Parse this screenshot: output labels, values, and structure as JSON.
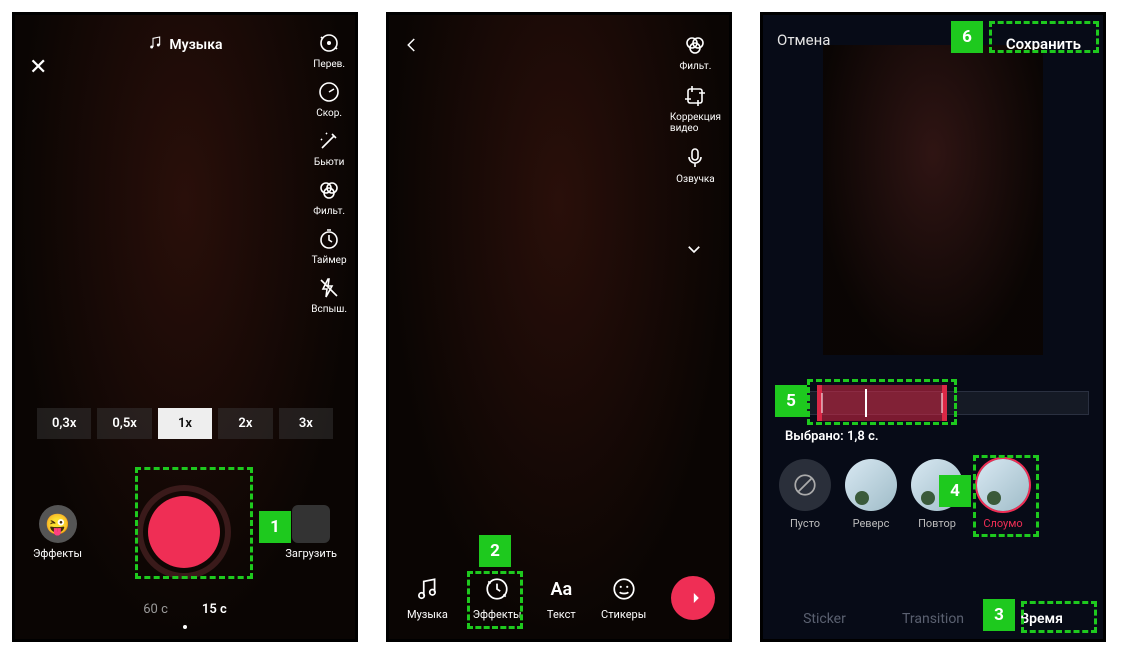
{
  "screen1": {
    "music_label": "Музыка",
    "tools": {
      "flip": "Перев.",
      "speed": "Скор.",
      "beauty": "Бьюти",
      "filter": "Фильт.",
      "timer": "Таймер",
      "flash": "Вспыш."
    },
    "speeds": [
      "0,3x",
      "0,5x",
      "1x",
      "2x",
      "3x"
    ],
    "speed_active_index": 2,
    "effects_label": "Эффекты",
    "upload_label": "Загрузить",
    "durations": [
      "60 с",
      "15 с"
    ],
    "duration_active_index": 1,
    "step_badge": "1"
  },
  "screen2": {
    "tools": {
      "filter": "Фильт.",
      "correction_l1": "Коррекция",
      "correction_l2": "видео",
      "voice": "Озвучка"
    },
    "bottom": {
      "music": "Музыка",
      "effects": "Эффекты",
      "text": "Текст",
      "stickers": "Стикеры"
    },
    "step_badge": "2"
  },
  "screen3": {
    "cancel": "Отмена",
    "save": "Сохранить",
    "selected_prefix": "Выбрано: ",
    "selected_value": "1,8 с.",
    "effects": {
      "empty": "Пусто",
      "reverse": "Реверс",
      "repeat": "Повтор",
      "slomo": "Слоумо"
    },
    "tabs": {
      "sticker": "Sticker",
      "transition": "Transition",
      "time": "Время"
    },
    "step_badges": {
      "s3": "3",
      "s4": "4",
      "s5": "5",
      "s6": "6"
    }
  }
}
